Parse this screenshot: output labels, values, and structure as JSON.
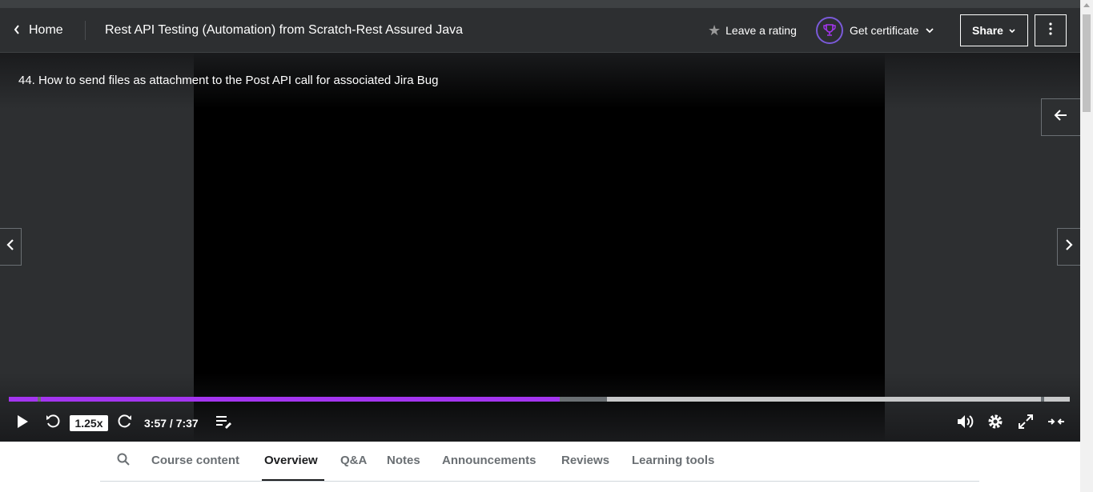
{
  "header": {
    "home_label": "Home",
    "course_title": "Rest API Testing (Automation) from Scratch-Rest Assured Java",
    "rating_label": "Leave a rating",
    "certificate_label": "Get certificate",
    "share_label": "Share",
    "colors": {
      "background": "#2d2f31",
      "accent": "#a435f0"
    }
  },
  "player": {
    "lecture_title": "44. How to send files as attachment to the Post API call for associated Jira Bug",
    "speed": "1.25x",
    "time_display": "3:57 / 7:37",
    "progress_played_fraction": 0.519,
    "progress_buffered_fraction": 0.564,
    "icons": [
      "play-icon",
      "rewind-icon",
      "forward-icon",
      "transcript-icon",
      "volume-icon",
      "settings-icon",
      "fullscreen-icon",
      "theater-mode-icon"
    ]
  },
  "tabs": {
    "items": [
      "Course content",
      "Overview",
      "Q&A",
      "Notes",
      "Announcements",
      "Reviews",
      "Learning tools"
    ],
    "active": "Overview"
  }
}
